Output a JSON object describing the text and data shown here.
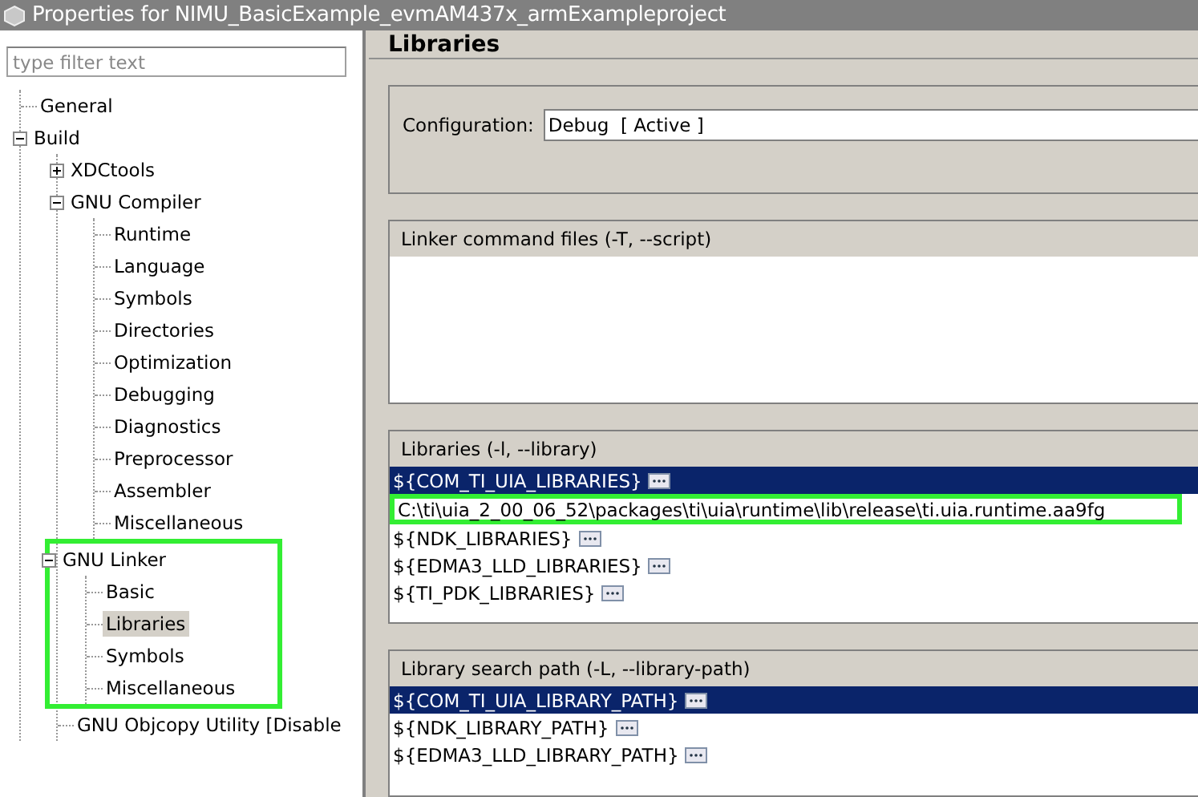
{
  "window": {
    "title": "Properties for NIMU_BasicExample_evmAM437x_armExampleproject"
  },
  "sidebar": {
    "filter": {
      "placeholder": "type filter text"
    },
    "tree": [
      {
        "label": "General",
        "selected": false
      },
      {
        "label": "Build",
        "selected": false,
        "expanded": true,
        "children": [
          {
            "label": "XDCtools",
            "selected": false,
            "expanded": false
          },
          {
            "label": "GNU Compiler",
            "selected": false,
            "expanded": true,
            "children": [
              {
                "label": "Runtime",
                "selected": false
              },
              {
                "label": "Language",
                "selected": false
              },
              {
                "label": "Symbols",
                "selected": false
              },
              {
                "label": "Directories",
                "selected": false
              },
              {
                "label": "Optimization",
                "selected": false
              },
              {
                "label": "Debugging",
                "selected": false
              },
              {
                "label": "Diagnostics",
                "selected": false
              },
              {
                "label": "Preprocessor",
                "selected": false
              },
              {
                "label": "Assembler",
                "selected": false
              },
              {
                "label": "Miscellaneous",
                "selected": false
              }
            ]
          },
          {
            "label": "GNU Linker",
            "selected": false,
            "expanded": true,
            "highlighted": true,
            "children": [
              {
                "label": "Basic",
                "selected": false
              },
              {
                "label": "Libraries",
                "selected": true
              },
              {
                "label": "Symbols",
                "selected": false
              },
              {
                "label": "Miscellaneous",
                "selected": false
              }
            ]
          },
          {
            "label": "GNU Objcopy Utility  [Disable",
            "selected": false
          }
        ]
      }
    ]
  },
  "page": {
    "title": "Libraries",
    "configuration": {
      "label": "Configuration:",
      "value": "Debug  [ Active ]"
    },
    "lists": [
      {
        "title": "Linker command files (-T, --script)"
      },
      {
        "title": "Libraries (-l, --library)",
        "rows": [
          {
            "text": "${COM_TI_UIA_LIBRARIES}",
            "kind": "variable",
            "selected": true,
            "highlighted": false
          },
          {
            "text": "C:\\ti\\uia_2_00_06_52\\packages\\ti\\uia\\runtime\\lib\\release\\ti.uia.runtime.aa9fg",
            "kind": "path",
            "selected": false,
            "highlighted": true
          },
          {
            "text": "${NDK_LIBRARIES}",
            "kind": "variable",
            "selected": false,
            "highlighted": false
          },
          {
            "text": "${EDMA3_LLD_LIBRARIES}",
            "kind": "variable",
            "selected": false,
            "highlighted": false
          },
          {
            "text": "${TI_PDK_LIBRARIES}",
            "kind": "variable",
            "selected": false,
            "highlighted": false
          }
        ]
      },
      {
        "title": "Library search path (-L, --library-path)",
        "rows": [
          {
            "text": "${COM_TI_UIA_LIBRARY_PATH}",
            "kind": "variable",
            "selected": true,
            "highlighted": false
          },
          {
            "text": "${NDK_LIBRARY_PATH}",
            "kind": "variable",
            "selected": false,
            "highlighted": false
          },
          {
            "text": "${EDMA3_LLD_LIBRARY_PATH}",
            "kind": "variable",
            "selected": false,
            "highlighted": false
          }
        ]
      }
    ]
  }
}
